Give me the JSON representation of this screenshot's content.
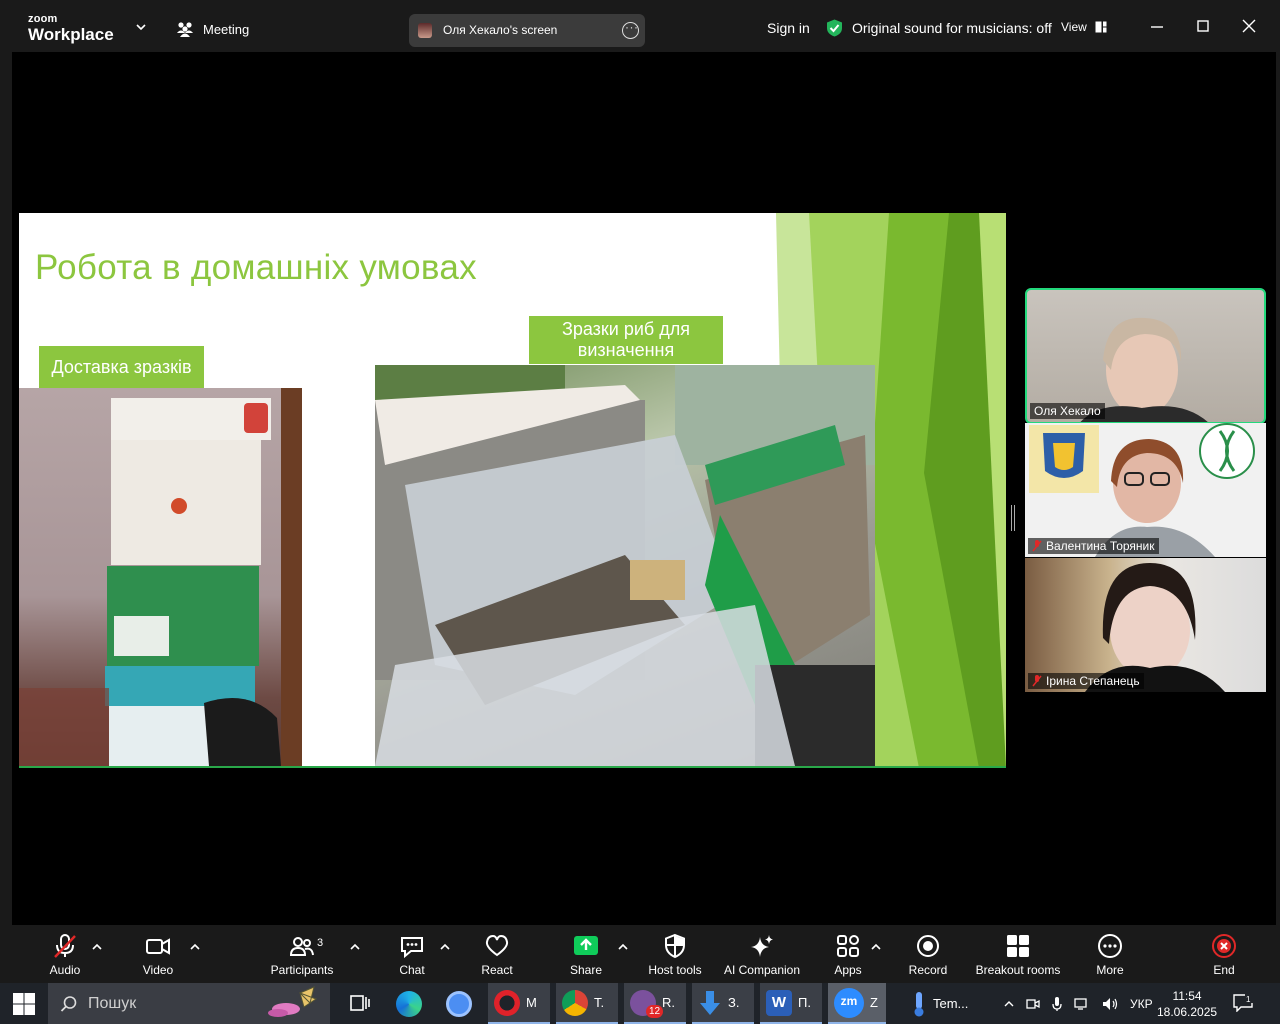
{
  "titlebar": {
    "logo_small": "zoom",
    "logo_big": "Workplace",
    "meeting_label": "Meeting",
    "screen_share_label": "Оля Хекало's screen",
    "sign_in": "Sign in",
    "sound_status": "Original sound for musicians: off",
    "view_label": "View"
  },
  "slide": {
    "title": "Робота в домашніх умовах",
    "label_delivery": "Доставка зразків",
    "label_samples": "Зразки риб для визначення"
  },
  "participants": [
    {
      "name": "Оля Хекало",
      "muted": false
    },
    {
      "name": "Валентина Торяник",
      "muted": true
    },
    {
      "name": "Ірина Степанець",
      "muted": true
    }
  ],
  "toolbar": {
    "audio": "Audio",
    "video": "Video",
    "participants": "Participants",
    "participants_count": "3",
    "chat": "Chat",
    "react": "React",
    "share": "Share",
    "host_tools": "Host tools",
    "ai_companion": "AI Companion",
    "apps": "Apps",
    "record": "Record",
    "breakout_rooms": "Breakout rooms",
    "more": "More",
    "end": "End"
  },
  "taskbar": {
    "search_placeholder": "Пошук",
    "opera_label": "М",
    "chrome_label": "Т.",
    "viber_label": "R.",
    "viber_badge": "12",
    "download_label": "З.",
    "word_label": "П.",
    "zoom_label": "Z",
    "weather_label": "Tem...",
    "language": "УКР",
    "time": "11:54",
    "date": "18.06.2025"
  },
  "colors": {
    "accent_green": "#8cc63f",
    "active_speaker": "#23d97c",
    "share_green": "#0fcc5a",
    "end_red": "#e02828"
  }
}
